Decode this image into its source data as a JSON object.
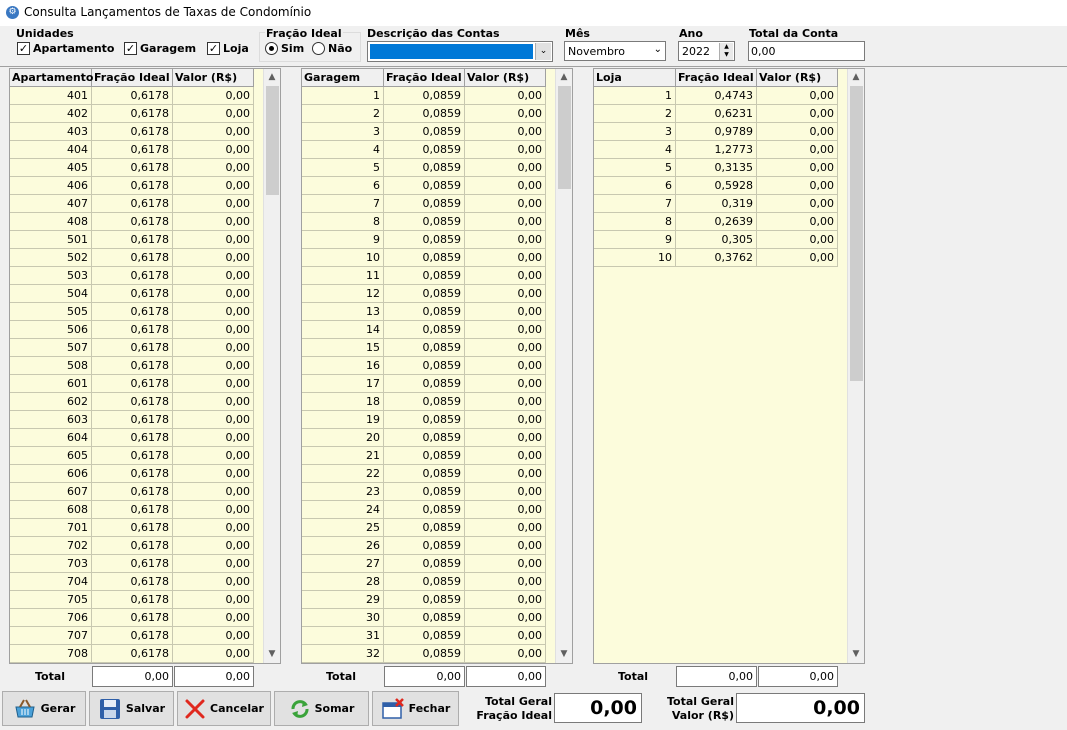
{
  "window": {
    "title": "Consulta Lançamentos de Taxas de Condomínio"
  },
  "filters": {
    "unidades": {
      "label": "Unidades",
      "apartamento": "Apartamento",
      "garagem": "Garagem",
      "loja": "Loja"
    },
    "fracao_ideal": {
      "label": "Fração Ideal",
      "sim": "Sim",
      "nao": "Não",
      "selected": "Sim"
    },
    "descricao": {
      "label": "Descrição das Contas",
      "value": ""
    },
    "mes": {
      "label": "Mês",
      "value": "Novembro"
    },
    "ano": {
      "label": "Ano",
      "value": "2022"
    },
    "total_conta": {
      "label": "Total da Conta",
      "value": "0,00"
    }
  },
  "grids": {
    "apartamento": {
      "headers": [
        "Apartamento",
        "Fração Ideal",
        "Valor (R$)"
      ],
      "rows": [
        [
          "401",
          "0,6178",
          "0,00"
        ],
        [
          "402",
          "0,6178",
          "0,00"
        ],
        [
          "403",
          "0,6178",
          "0,00"
        ],
        [
          "404",
          "0,6178",
          "0,00"
        ],
        [
          "405",
          "0,6178",
          "0,00"
        ],
        [
          "406",
          "0,6178",
          "0,00"
        ],
        [
          "407",
          "0,6178",
          "0,00"
        ],
        [
          "408",
          "0,6178",
          "0,00"
        ],
        [
          "501",
          "0,6178",
          "0,00"
        ],
        [
          "502",
          "0,6178",
          "0,00"
        ],
        [
          "503",
          "0,6178",
          "0,00"
        ],
        [
          "504",
          "0,6178",
          "0,00"
        ],
        [
          "505",
          "0,6178",
          "0,00"
        ],
        [
          "506",
          "0,6178",
          "0,00"
        ],
        [
          "507",
          "0,6178",
          "0,00"
        ],
        [
          "508",
          "0,6178",
          "0,00"
        ],
        [
          "601",
          "0,6178",
          "0,00"
        ],
        [
          "602",
          "0,6178",
          "0,00"
        ],
        [
          "603",
          "0,6178",
          "0,00"
        ],
        [
          "604",
          "0,6178",
          "0,00"
        ],
        [
          "605",
          "0,6178",
          "0,00"
        ],
        [
          "606",
          "0,6178",
          "0,00"
        ],
        [
          "607",
          "0,6178",
          "0,00"
        ],
        [
          "608",
          "0,6178",
          "0,00"
        ],
        [
          "701",
          "0,6178",
          "0,00"
        ],
        [
          "702",
          "0,6178",
          "0,00"
        ],
        [
          "703",
          "0,6178",
          "0,00"
        ],
        [
          "704",
          "0,6178",
          "0,00"
        ],
        [
          "705",
          "0,6178",
          "0,00"
        ],
        [
          "706",
          "0,6178",
          "0,00"
        ],
        [
          "707",
          "0,6178",
          "0,00"
        ],
        [
          "708",
          "0,6178",
          "0,00"
        ]
      ],
      "total_label": "Total",
      "total_fracao": "0,00",
      "total_valor": "0,00"
    },
    "garagem": {
      "headers": [
        "Garagem",
        "Fração Ideal",
        "Valor (R$)"
      ],
      "rows": [
        [
          "1",
          "0,0859",
          "0,00"
        ],
        [
          "2",
          "0,0859",
          "0,00"
        ],
        [
          "3",
          "0,0859",
          "0,00"
        ],
        [
          "4",
          "0,0859",
          "0,00"
        ],
        [
          "5",
          "0,0859",
          "0,00"
        ],
        [
          "6",
          "0,0859",
          "0,00"
        ],
        [
          "7",
          "0,0859",
          "0,00"
        ],
        [
          "8",
          "0,0859",
          "0,00"
        ],
        [
          "9",
          "0,0859",
          "0,00"
        ],
        [
          "10",
          "0,0859",
          "0,00"
        ],
        [
          "11",
          "0,0859",
          "0,00"
        ],
        [
          "12",
          "0,0859",
          "0,00"
        ],
        [
          "13",
          "0,0859",
          "0,00"
        ],
        [
          "14",
          "0,0859",
          "0,00"
        ],
        [
          "15",
          "0,0859",
          "0,00"
        ],
        [
          "16",
          "0,0859",
          "0,00"
        ],
        [
          "17",
          "0,0859",
          "0,00"
        ],
        [
          "18",
          "0,0859",
          "0,00"
        ],
        [
          "19",
          "0,0859",
          "0,00"
        ],
        [
          "20",
          "0,0859",
          "0,00"
        ],
        [
          "21",
          "0,0859",
          "0,00"
        ],
        [
          "22",
          "0,0859",
          "0,00"
        ],
        [
          "23",
          "0,0859",
          "0,00"
        ],
        [
          "24",
          "0,0859",
          "0,00"
        ],
        [
          "25",
          "0,0859",
          "0,00"
        ],
        [
          "26",
          "0,0859",
          "0,00"
        ],
        [
          "27",
          "0,0859",
          "0,00"
        ],
        [
          "28",
          "0,0859",
          "0,00"
        ],
        [
          "29",
          "0,0859",
          "0,00"
        ],
        [
          "30",
          "0,0859",
          "0,00"
        ],
        [
          "31",
          "0,0859",
          "0,00"
        ],
        [
          "32",
          "0,0859",
          "0,00"
        ]
      ],
      "total_label": "Total",
      "total_fracao": "0,00",
      "total_valor": "0,00"
    },
    "loja": {
      "headers": [
        "Loja",
        "Fração Ideal",
        "Valor (R$)"
      ],
      "rows": [
        [
          "1",
          "0,4743",
          "0,00"
        ],
        [
          "2",
          "0,6231",
          "0,00"
        ],
        [
          "3",
          "0,9789",
          "0,00"
        ],
        [
          "4",
          "1,2773",
          "0,00"
        ],
        [
          "5",
          "0,3135",
          "0,00"
        ],
        [
          "6",
          "0,5928",
          "0,00"
        ],
        [
          "7",
          "0,319",
          "0,00"
        ],
        [
          "8",
          "0,2639",
          "0,00"
        ],
        [
          "9",
          "0,305",
          "0,00"
        ],
        [
          "10",
          "0,3762",
          "0,00"
        ]
      ],
      "total_label": "Total",
      "total_fracao": "0,00",
      "total_valor": "0,00"
    }
  },
  "buttons": {
    "gerar": "Gerar",
    "salvar": "Salvar",
    "cancelar": "Cancelar",
    "somar": "Somar",
    "fechar": "Fechar"
  },
  "totals": {
    "fracao_label_1": "Total Geral",
    "fracao_label_2": "Fração Ideal",
    "fracao_value": "0,00",
    "valor_label_1": "Total Geral",
    "valor_label_2": "Valor (R$)",
    "valor_value": "0,00"
  }
}
